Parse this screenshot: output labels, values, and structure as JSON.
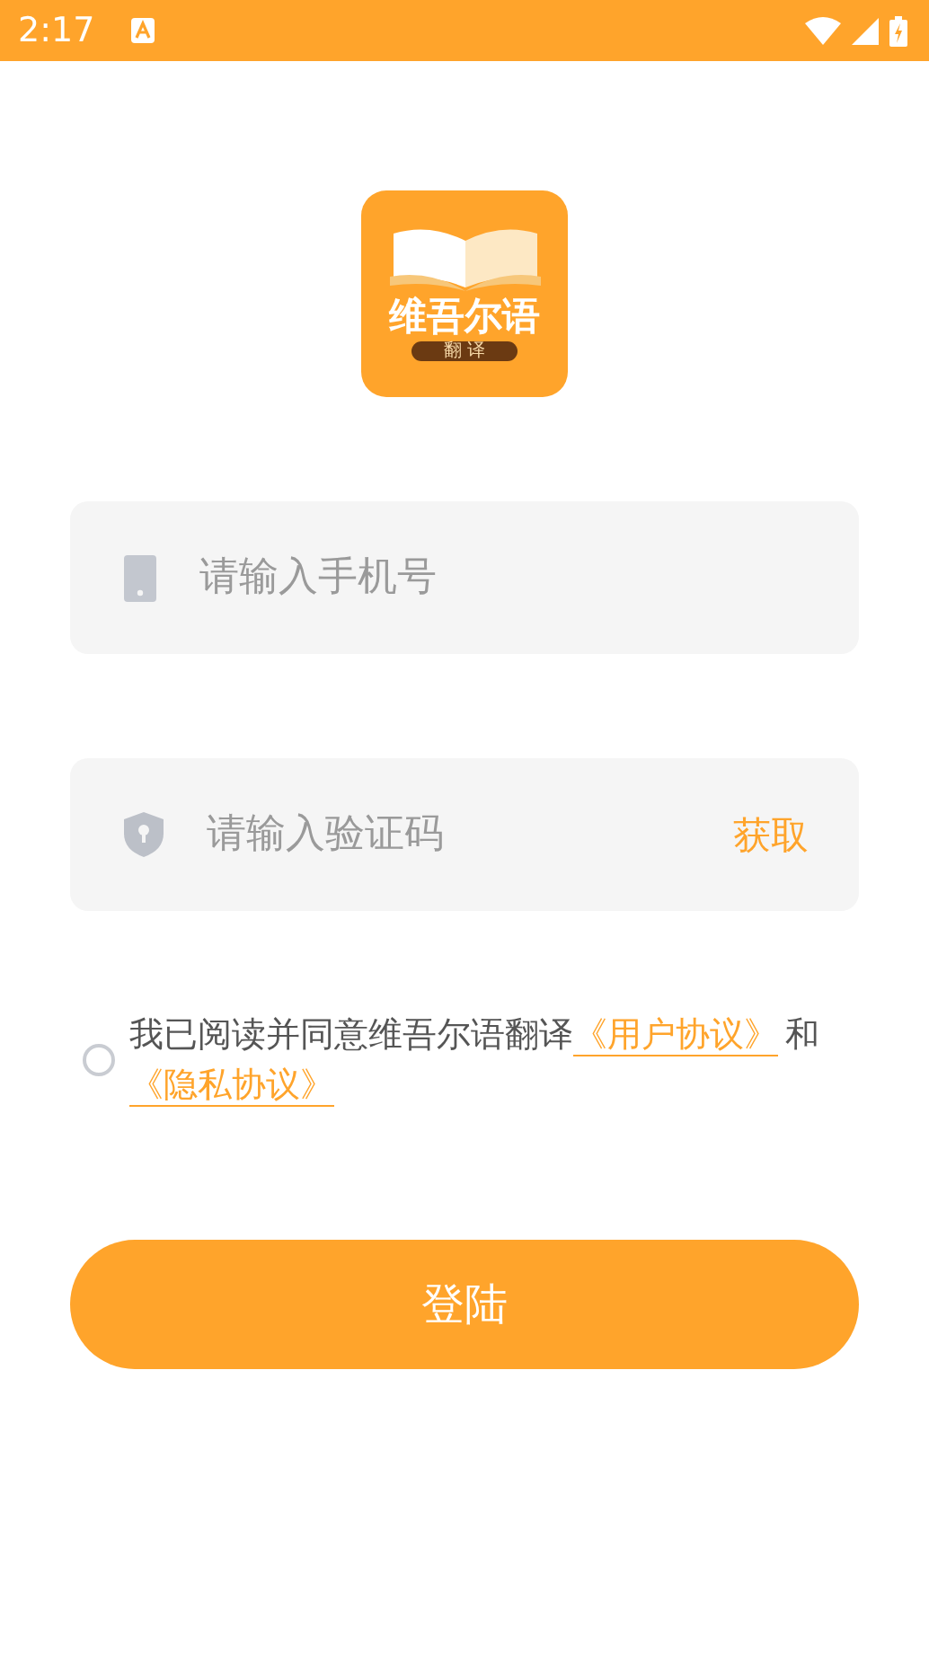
{
  "status_bar": {
    "time": "2:17"
  },
  "logo": {
    "title": "维吾尔语",
    "subtitle": "翻 译"
  },
  "fields": [
    {
      "kind": "phone",
      "placeholder": "请输入手机号"
    },
    {
      "kind": "code",
      "placeholder": "请输入验证码",
      "action": "获取"
    }
  ],
  "agreement": {
    "checked": false,
    "parts": [
      {
        "kind": "text",
        "text": "我已阅读并同意维吾尔语翻译"
      },
      {
        "kind": "link",
        "text": "《用户协议》"
      },
      {
        "kind": "text",
        "text": "和"
      },
      {
        "kind": "link",
        "text": "《隐私协议》"
      }
    ]
  },
  "login_button": "登陆"
}
